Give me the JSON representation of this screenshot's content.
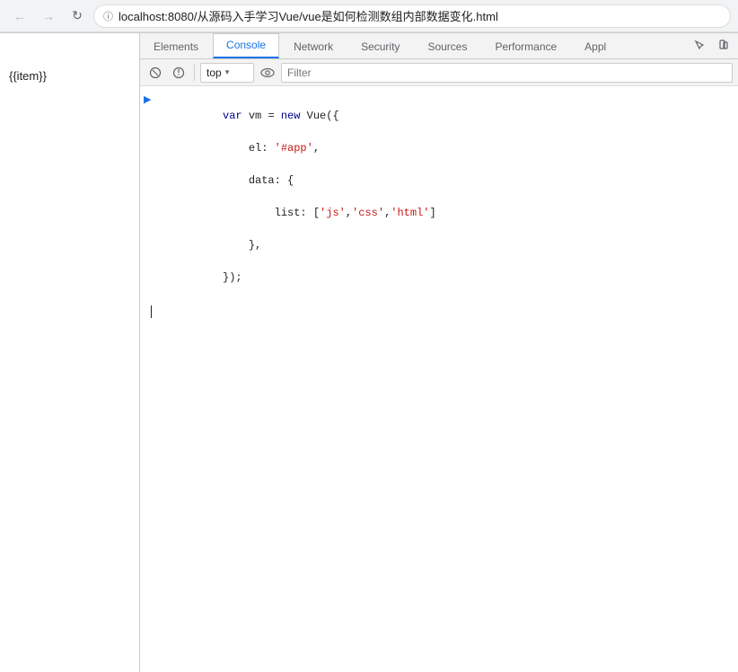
{
  "browser": {
    "url": "localhost:8080/从源码入手学习Vue/vue是如何检测数组内部数据变化.html",
    "url_full": "⊙ localhost:8080/从源码入手学习Vue/vue是如何检测数组内部数据变化.html"
  },
  "page_content": {
    "template_text": "{{item}}"
  },
  "devtools": {
    "tabs": [
      {
        "id": "elements",
        "label": "Elements",
        "active": false
      },
      {
        "id": "console",
        "label": "Console",
        "active": true
      },
      {
        "id": "network",
        "label": "Network",
        "active": false
      },
      {
        "id": "security",
        "label": "Security",
        "active": false
      },
      {
        "id": "sources",
        "label": "Sources",
        "active": false
      },
      {
        "id": "performance",
        "label": "Performance",
        "active": false
      },
      {
        "id": "application",
        "label": "Appl",
        "active": false
      }
    ],
    "toolbar": {
      "context_selector": "top",
      "filter_placeholder": "Filter"
    },
    "console_code": {
      "line1": "var vm = new Vue({",
      "line2": "    el: '#app',",
      "line3": "    data: {",
      "line4": "        list: ['js','css','html']",
      "line5": "    },",
      "line6": "});"
    }
  },
  "icons": {
    "back": "←",
    "forward": "→",
    "reload": "↻",
    "lock": "🔒",
    "cursor_tool": "⊹",
    "mobile": "▭",
    "stop": "⊘",
    "dropdown_arrow": "▾",
    "eye": "👁",
    "console_expand": "▶",
    "panel_icon_1": "⊡",
    "panel_icon_2": "⊞",
    "three_dots": "⋮"
  }
}
